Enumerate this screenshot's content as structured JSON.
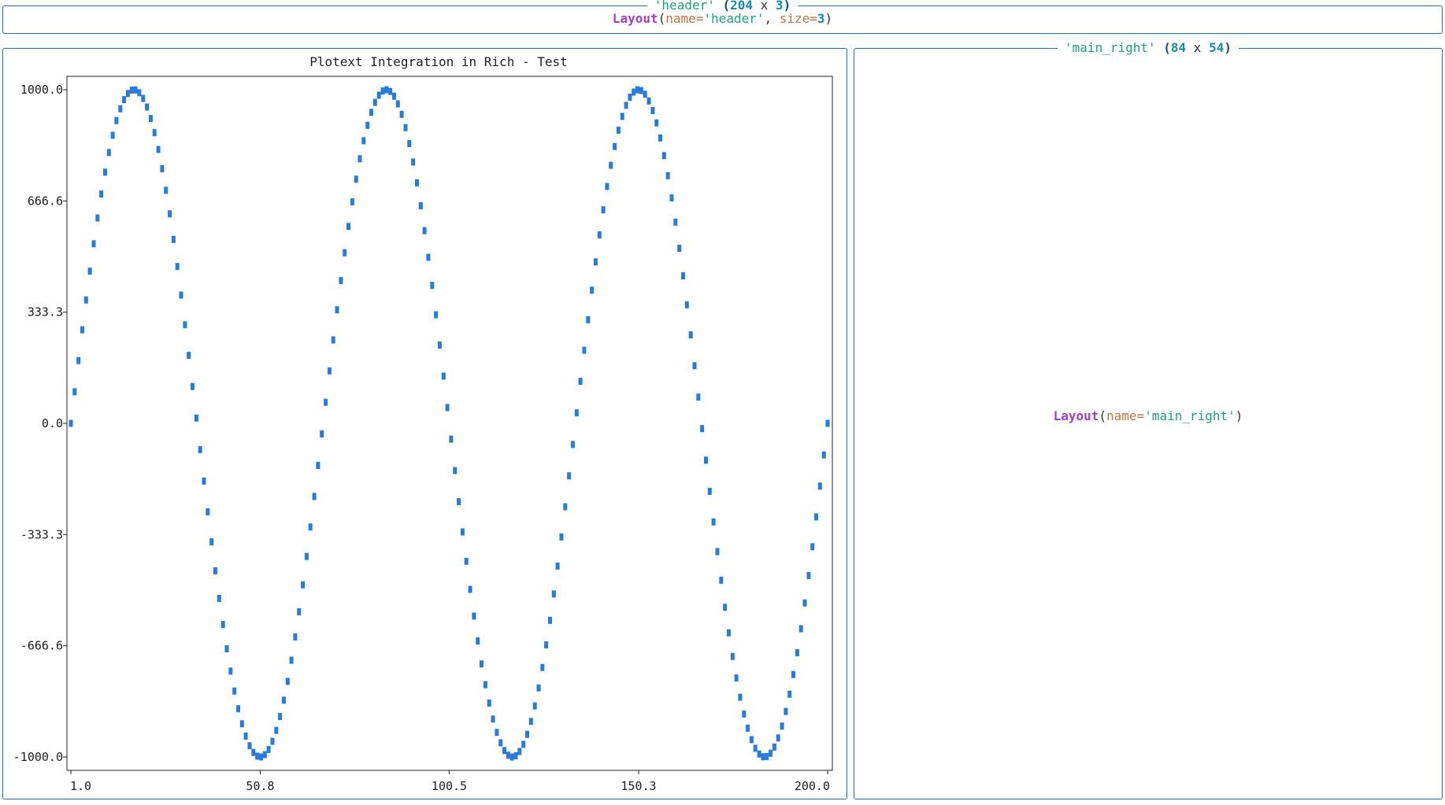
{
  "header": {
    "title": {
      "name_quoted": "'header'",
      "open_paren": " (",
      "width": "204",
      "x": " x ",
      "height": "3",
      "close_paren": ")"
    },
    "content": {
      "fn": "Layout",
      "open": "(",
      "name_key": "name=",
      "name_val": "'header'",
      "sep": ", ",
      "size_key": "size=",
      "size_val": "3",
      "close": ")"
    }
  },
  "main_right": {
    "title": {
      "name_quoted": "'main_right'",
      "open_paren": " (",
      "width": "84",
      "x": " x ",
      "height": "54",
      "close_paren": ")"
    },
    "content": {
      "fn": "Layout",
      "open": "(",
      "name_key": "name=",
      "name_val": "'main_right'",
      "close": ")"
    }
  },
  "colors": {
    "border": "#2a6db0",
    "series": "#2a7bd8"
  },
  "chart_data": {
    "type": "scatter",
    "title": "Plotext Integration in Rich - Test",
    "xlabel": "",
    "ylabel": "",
    "x_ticks": [
      "1.0",
      "50.8",
      "100.5",
      "150.3",
      "200.0"
    ],
    "x_tick_values": [
      1.0,
      50.8,
      100.5,
      150.3,
      200.0
    ],
    "y_ticks": [
      "1000.0",
      "666.6",
      "333.3",
      "0.0",
      "-333.3",
      "-666.6",
      "-1000.0"
    ],
    "y_tick_values": [
      1000.0,
      666.6,
      333.3,
      0.0,
      -333.3,
      -666.6,
      -1000.0
    ],
    "xlim": [
      1.0,
      200.0
    ],
    "ylim": [
      -1000.0,
      1000.0
    ],
    "grid": false,
    "series": [
      {
        "function": "1000 * sin(2*pi*3*(x-1)/199)",
        "x_start": 1,
        "x_end": 200,
        "x_step": 1,
        "color": "#2a7bd8"
      }
    ]
  }
}
